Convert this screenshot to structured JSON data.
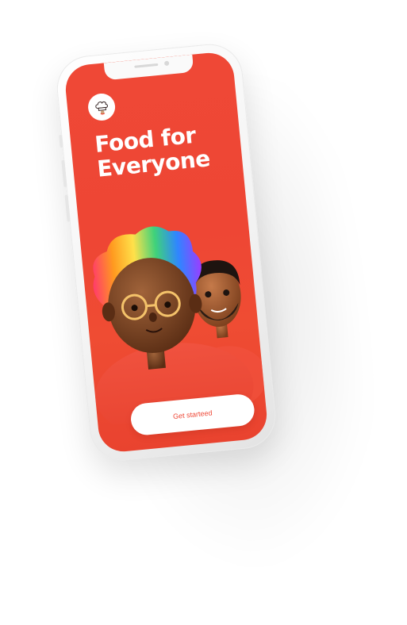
{
  "app": {
    "logo_icon": "chef-hat-icon",
    "headline_line1": "Food for",
    "headline_line2": "Everyone",
    "cta_label": "Get starteed"
  },
  "illustration": {
    "description_icon": "avatars-illustration"
  },
  "colors": {
    "brand": "#EE4634",
    "cta_background": "#FFFFFF",
    "cta_text": "#EE4634",
    "device_frame": "#F4F4F4"
  }
}
